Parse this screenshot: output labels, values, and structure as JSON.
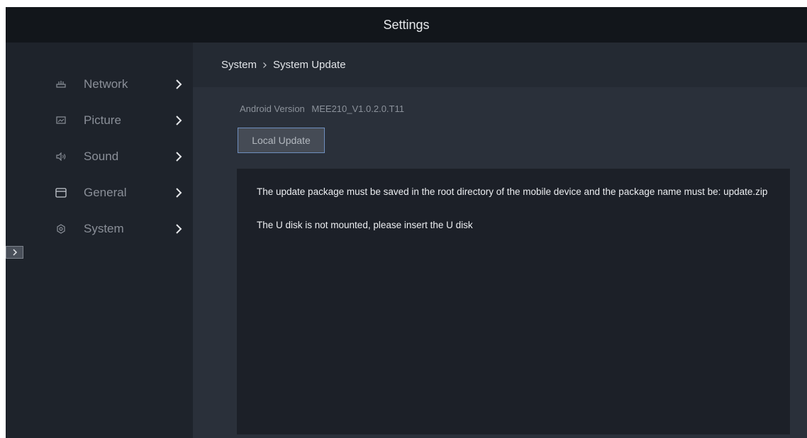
{
  "header": {
    "title": "Settings"
  },
  "sidebar": {
    "items": [
      {
        "label": "Network",
        "icon": "network-icon"
      },
      {
        "label": "Picture",
        "icon": "picture-icon"
      },
      {
        "label": "Sound",
        "icon": "sound-icon"
      },
      {
        "label": "General",
        "icon": "general-icon"
      },
      {
        "label": "System",
        "icon": "system-icon"
      }
    ]
  },
  "breadcrumb": {
    "parent": "System",
    "current": "System Update"
  },
  "main": {
    "version_label": "Android Version",
    "version_value": "MEE210_V1.0.2.0.T11",
    "local_update_label": "Local Update",
    "info_lines": [
      "The update package must be saved in the root directory of the mobile device and the package name must be: update.zip",
      "The U disk is not mounted, please insert the U disk"
    ]
  },
  "colors": {
    "background": "#1e232b",
    "titlebar": "#12161b",
    "content": "#2a303a",
    "panel": "#1c2028",
    "button_border": "#6f8fbf"
  }
}
